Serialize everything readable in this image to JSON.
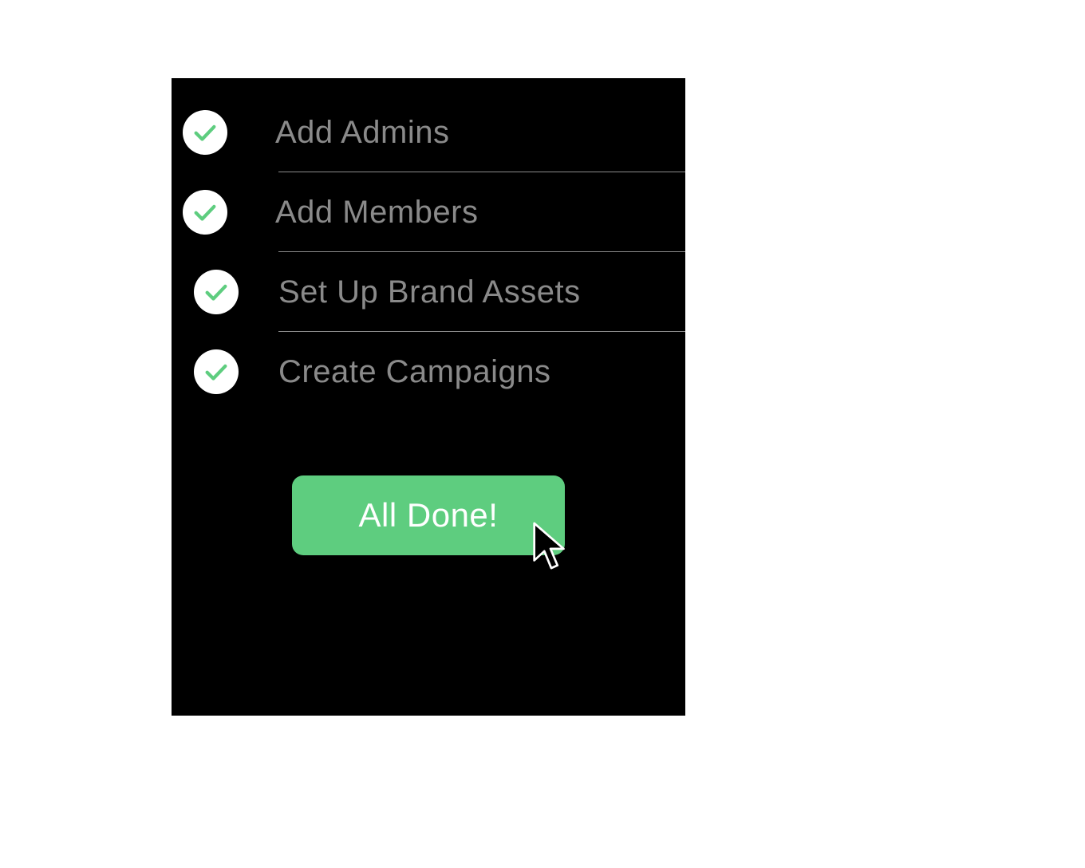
{
  "colors": {
    "accent": "#5ecd7f",
    "panelBg": "#000000",
    "labelText": "#8a8a8a",
    "circle": "#ffffff"
  },
  "checklist": {
    "items": [
      {
        "label": "Add Admins",
        "done": true
      },
      {
        "label": "Add Members",
        "done": true
      },
      {
        "label": "Set Up Brand Assets",
        "done": true
      },
      {
        "label": "Create Campaigns",
        "done": true
      }
    ]
  },
  "action": {
    "doneLabel": "All Done!"
  }
}
